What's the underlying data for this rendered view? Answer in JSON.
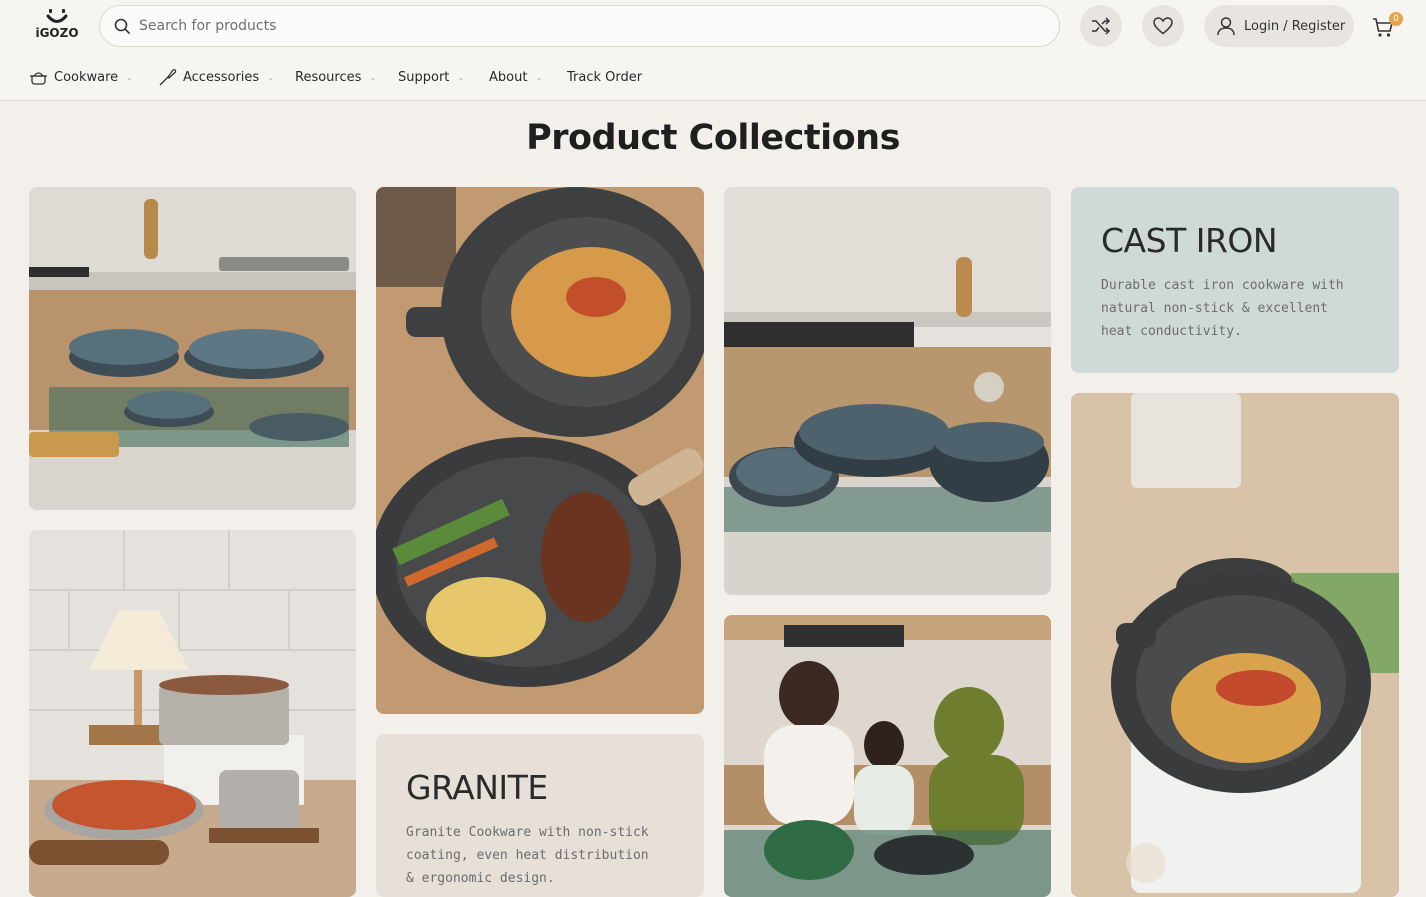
{
  "header": {
    "logo_text": "iGOZO",
    "search_placeholder": "Search for products",
    "login_label": "Login / Register",
    "cart_count": "0"
  },
  "nav": {
    "items": [
      {
        "label": "Cookware",
        "icon": "pot-icon",
        "has_dropdown": true
      },
      {
        "label": "Accessories",
        "icon": "spatula-icon",
        "has_dropdown": true
      },
      {
        "label": "Resources",
        "has_dropdown": true
      },
      {
        "label": "Support",
        "has_dropdown": true
      },
      {
        "label": "About",
        "has_dropdown": true
      },
      {
        "label": "Track Order",
        "has_dropdown": false
      }
    ]
  },
  "main": {
    "title": "Product Collections",
    "collections": [
      {
        "name": "CAST IRON",
        "description": "Durable cast iron cookware with natural non-stick & excellent heat conductivity."
      },
      {
        "name": "GRANITE",
        "description": "Granite Cookware with non-stick coating, even heat distribution & ergonomic design."
      }
    ]
  },
  "colors": {
    "page_bg": "#f3f0ec",
    "cast_iron_card_bg": "#cfdad8",
    "granite_card_bg": "#e6e0d9",
    "badge": "#e6a34a"
  }
}
